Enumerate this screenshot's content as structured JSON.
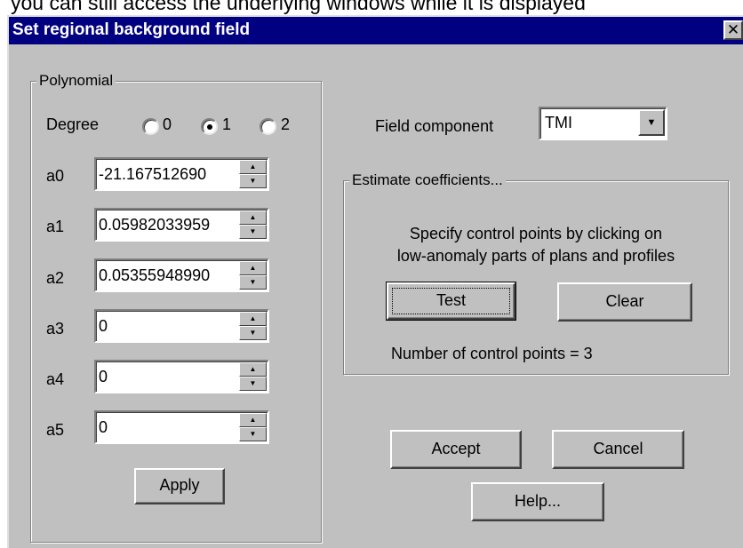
{
  "background_text": "you can still access the underlying windows while it is displayed",
  "window": {
    "title": "Set regional background field"
  },
  "polynomial": {
    "group_label": "Polynomial",
    "degree_label": "Degree",
    "degree_options": [
      "0",
      "1",
      "2"
    ],
    "selected_degree": "1",
    "coefficients": [
      {
        "label": "a0",
        "value": "-21.167512690"
      },
      {
        "label": "a1",
        "value": "0.05982033959"
      },
      {
        "label": "a2",
        "value": "0.05355948990"
      },
      {
        "label": "a3",
        "value": "0"
      },
      {
        "label": "a4",
        "value": "0"
      },
      {
        "label": "a5",
        "value": "0"
      }
    ],
    "apply_label": "Apply"
  },
  "field_component": {
    "label": "Field component",
    "value": "TMI"
  },
  "estimate": {
    "group_label": "Estimate coefficients...",
    "instruction_line1": "Specify control points by clicking on",
    "instruction_line2": "low-anomaly parts of plans and profiles",
    "test_label": "Test",
    "clear_label": "Clear",
    "control_points_label": "Number of control points =  3"
  },
  "buttons": {
    "accept": "Accept",
    "cancel": "Cancel",
    "help": "Help..."
  },
  "colors": {
    "dialog_bg": "#c0c0c0",
    "titlebar": "#000080"
  }
}
